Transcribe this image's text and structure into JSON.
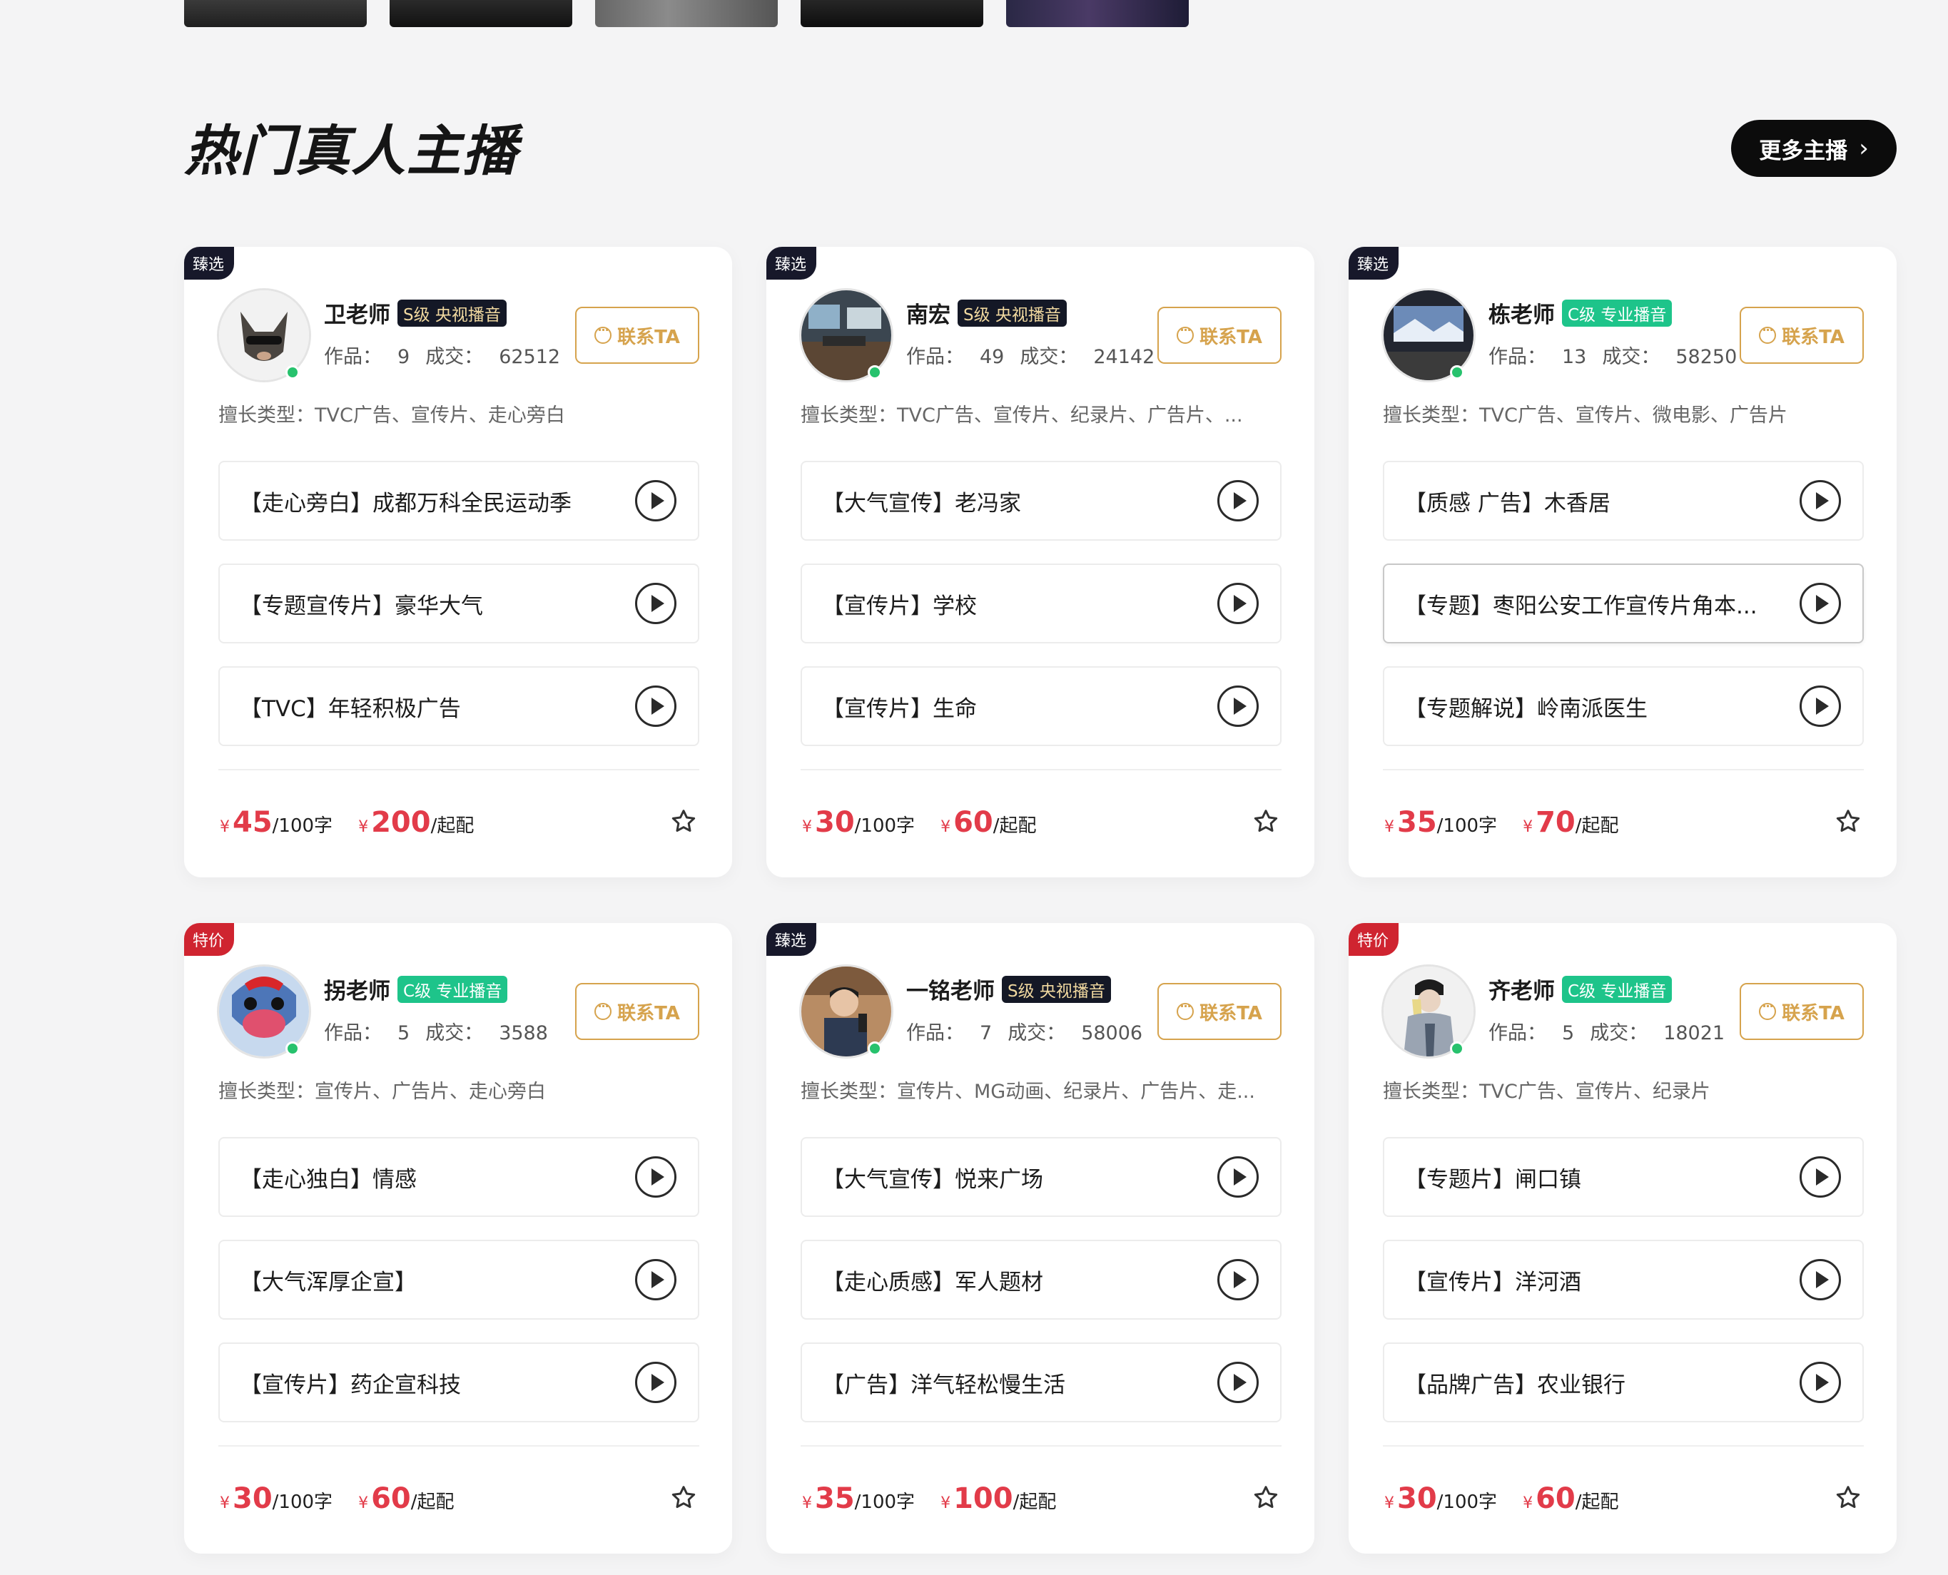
{
  "section": {
    "title": "热门真人主播",
    "more_label": "更多主播"
  },
  "contact_label": "联系TA",
  "stats_labels": {
    "works": "作品：",
    "deals": "成交："
  },
  "specialty_prefix": "擅长类型：",
  "price_units": {
    "per_word": "/100字",
    "start": "/起配",
    "currency": "¥"
  },
  "colors": {
    "price_red": "#e23b49",
    "contact_gold": "#d6a34d",
    "level_s_bg": "#141826",
    "level_c_bg": "#1ec48a",
    "tag_select_bg": "#17182a",
    "tag_sale_bg": "#cf2430"
  },
  "anchors": [
    {
      "tag": "臻选",
      "tag_type": "select",
      "name": "卫老师",
      "level": "S级 央视播音",
      "level_type": "s",
      "works": "9",
      "deals": "62512",
      "specialty": "TVC广告、宣传片、走心旁白",
      "items": [
        "【走心旁白】成都万科全民运动季",
        "【专题宣传片】豪华大气",
        "【TVC】年轻积极广告"
      ],
      "price_word": "45",
      "price_start": "200"
    },
    {
      "tag": "臻选",
      "tag_type": "select",
      "name": "南宏",
      "level": "S级 央视播音",
      "level_type": "s",
      "works": "49",
      "deals": "24142",
      "specialty": "TVC广告、宣传片、纪录片、广告片、...",
      "items": [
        "【大气宣传】老冯家",
        "【宣传片】学校",
        "【宣传片】生命"
      ],
      "price_word": "30",
      "price_start": "60"
    },
    {
      "tag": "臻选",
      "tag_type": "select",
      "name": "栋老师",
      "level": "C级 专业播音",
      "level_type": "c",
      "works": "13",
      "deals": "58250",
      "specialty": "TVC广告、宣传片、微电影、广告片",
      "items": [
        "【质感 广告】木香居",
        "【专题】枣阳公安工作宣传片角本...",
        "【专题解说】岭南派医生"
      ],
      "price_word": "35",
      "price_start": "70"
    },
    {
      "tag": "特价",
      "tag_type": "sale",
      "name": "拐老师",
      "level": "C级 专业播音",
      "level_type": "c",
      "works": "5",
      "deals": "3588",
      "specialty": "宣传片、广告片、走心旁白",
      "items": [
        "【走心独白】情感",
        "【大气浑厚企宣】",
        "【宣传片】药企宣科技"
      ],
      "price_word": "30",
      "price_start": "60"
    },
    {
      "tag": "臻选",
      "tag_type": "select",
      "name": "一铭老师",
      "level": "S级 央视播音",
      "level_type": "s",
      "works": "7",
      "deals": "58006",
      "specialty": "宣传片、MG动画、纪录片、广告片、走...",
      "items": [
        "【大气宣传】悦来广场",
        "【走心质感】军人题材",
        "【广告】洋气轻松慢生活"
      ],
      "price_word": "35",
      "price_start": "100"
    },
    {
      "tag": "特价",
      "tag_type": "sale",
      "name": "齐老师",
      "level": "C级 专业播音",
      "level_type": "c",
      "works": "5",
      "deals": "18021",
      "specialty": "TVC广告、宣传片、纪录片",
      "items": [
        "【专题片】闸口镇",
        "【宣传片】洋河酒",
        "【品牌广告】农业银行"
      ],
      "price_word": "30",
      "price_start": "60"
    }
  ]
}
